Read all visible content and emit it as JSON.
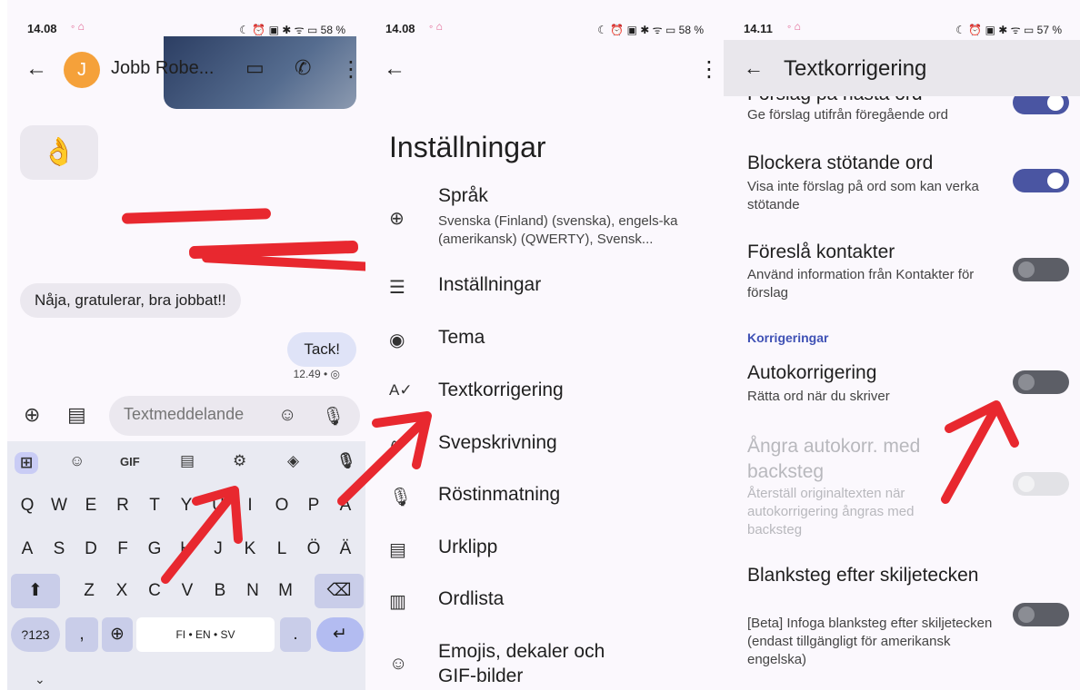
{
  "panel1": {
    "status": {
      "time": "14.08",
      "dots": "◦ ⌂",
      "right": "☾ ⏰ ▣ ✱ ᯤ ▭ 58 %"
    },
    "back_icon": "←",
    "avatar_letter": "J",
    "contact_name": "Jobb Robe...",
    "video_icon": "▭",
    "call_icon": "✆",
    "more_icon": "⋮",
    "emoji": "👌",
    "message_in": "Nåja, gratulerar, bra jobbat!!",
    "message_out": "Tack!",
    "message_time": "12.49 • ◎",
    "compose": {
      "add_icon": "⊕",
      "gallery_icon": "▤",
      "placeholder": "Textmeddelande",
      "emoji_icon": "☺",
      "mic_icon": "🎙"
    },
    "keyboard": {
      "toolbar": [
        "⊞",
        "☺",
        "GIF",
        "▤",
        "⚙",
        "◈",
        "🎙"
      ],
      "row1": [
        "Q",
        "W",
        "E",
        "R",
        "T",
        "Y",
        "U",
        "I",
        "O",
        "P",
        "Å"
      ],
      "row2": [
        "A",
        "S",
        "D",
        "F",
        "G",
        "H",
        "J",
        "K",
        "L",
        "Ö",
        "Ä"
      ],
      "row3": [
        "Z",
        "X",
        "C",
        "V",
        "B",
        "N",
        "M"
      ],
      "shift": "⬆",
      "backspace": "⌫",
      "numsw": "?123",
      "comma": ",",
      "globe": "⊕",
      "space": "FI • EN • SV",
      "period": ".",
      "enter": "↵",
      "collapse": "⌄"
    }
  },
  "panel2": {
    "status": {
      "time": "14.08",
      "dots": "◦ ⌂",
      "right": "☾ ⏰ ▣ ✱ ᯤ ▭ 58 %"
    },
    "back_icon": "←",
    "more_icon": "⋮",
    "title": "Inställningar",
    "items": [
      {
        "icon": "⊕",
        "label": "Språk",
        "sub": "Svenska (Finland) (svenska), engels-ka (amerikansk) (QWERTY), Svensk..."
      },
      {
        "icon": "☰",
        "label": "Inställningar"
      },
      {
        "icon": "◉",
        "label": "Tema"
      },
      {
        "icon": "A✓",
        "label": "Textkorrigering"
      },
      {
        "icon": "∿",
        "label": "Svepskrivning"
      },
      {
        "icon": "🎙",
        "label": "Röstinmatning"
      },
      {
        "icon": "▤",
        "label": "Urklipp"
      },
      {
        "icon": "▥",
        "label": "Ordlista"
      },
      {
        "icon": "☺",
        "label": "Emojis, dekaler och",
        "label2": "GIF-bilder"
      }
    ]
  },
  "panel3": {
    "status": {
      "time": "14.11",
      "dots": "◦ ⌂",
      "right": "☾ ⏰ ▣ ✱ ᯤ ▭ 57 %"
    },
    "back_icon": "←",
    "title": "Textkorrigering",
    "partial_title": "Förslag på nästa ord",
    "partial_sub": "Ge förslag utifrån föregående ord",
    "block_title": "Blockera stötande ord",
    "block_sub": "Visa inte förslag på ord som kan verka stötande",
    "contacts_title": "Föreslå kontakter",
    "contacts_sub": "Använd information från Kontakter för förslag",
    "section": "Korrigeringar",
    "autocorrect_title": "Autokorrigering",
    "autocorrect_sub": "Rätta ord när du skriver",
    "undo_title": "Ångra autokorr. med backsteg",
    "undo_sub": "Återställ originaltexten när autokorrigering ångras med backsteg",
    "space_title": "Blanksteg efter skiljetecken",
    "space_sub": "[Beta] Infoga blanksteg efter skiljetecken (endast tillgängligt för amerikansk engelska)",
    "toggles": {
      "next_word": true,
      "block": true,
      "contacts": false,
      "autocorrect": false,
      "undo": false,
      "space": false
    }
  },
  "colors": {
    "accent": "#4a55a2",
    "annotation": "#e8282f",
    "avatar": "#f5a13a"
  }
}
